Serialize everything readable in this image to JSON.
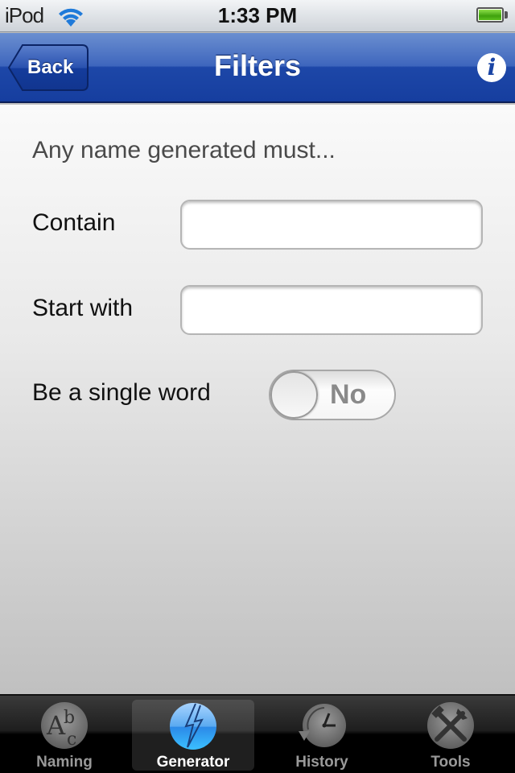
{
  "status_bar": {
    "carrier": "iPod",
    "time": "1:33 PM",
    "wifi_icon": "wifi-icon",
    "battery_icon": "battery-full-icon",
    "battery_level": 1.0
  },
  "nav_bar": {
    "back_label": "Back",
    "title": "Filters",
    "info_icon": "info-icon",
    "info_glyph": "i",
    "color": "#1d47a8"
  },
  "form": {
    "intro": "Any name generated must...",
    "contain": {
      "label": "Contain",
      "value": "",
      "placeholder": ""
    },
    "start_with": {
      "label": "Start with",
      "value": "",
      "placeholder": ""
    },
    "single_word": {
      "label": "Be a single word",
      "toggle_state": "No",
      "on": false
    }
  },
  "tab_bar": {
    "selected": "Generator",
    "tabs": [
      {
        "label": "Naming",
        "icon": "abc-icon"
      },
      {
        "label": "Generator",
        "icon": "lightning-icon"
      },
      {
        "label": "History",
        "icon": "history-clock-icon"
      },
      {
        "label": "Tools",
        "icon": "tools-icon"
      }
    ]
  }
}
